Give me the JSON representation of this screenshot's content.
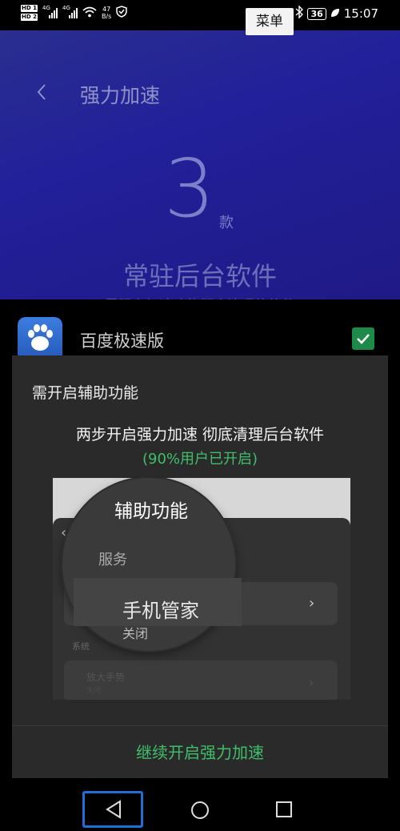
{
  "status_bar": {
    "hd1": "HD 1",
    "hd2": "HD 2",
    "sig1_label": "4G",
    "sig2_label": "4G",
    "speed_value": "47",
    "speed_unit": "B/s",
    "battery": "36",
    "time": "15:07"
  },
  "menu_chip": "菜单",
  "header": {
    "title": "强力加速",
    "count": "3",
    "unit": "款",
    "subtitle": "常驻后台软件",
    "description": "需强力加速才能彻底清理的软件"
  },
  "app_list": [
    {
      "name": "百度极速版",
      "checked": true
    }
  ],
  "dialog": {
    "title": "需开启辅助功能",
    "message": "两步开启强力加速 彻底清理后台软件",
    "percent_note": "(90%用户已开启)",
    "illustration": {
      "panel_title": "辅助功能",
      "section": "服务",
      "app_name": "手机管家",
      "app_state": "关闭",
      "system_label": "系统",
      "blurred_item": "放大手势",
      "blurred_state": "关闭"
    },
    "button": "继续开启强力加速"
  },
  "colors": {
    "header_bg": "#22209a",
    "accent_green": "#3fbf6a",
    "dialog_bg": "#2a2a2a",
    "nav_focus": "#1f6fd6"
  }
}
